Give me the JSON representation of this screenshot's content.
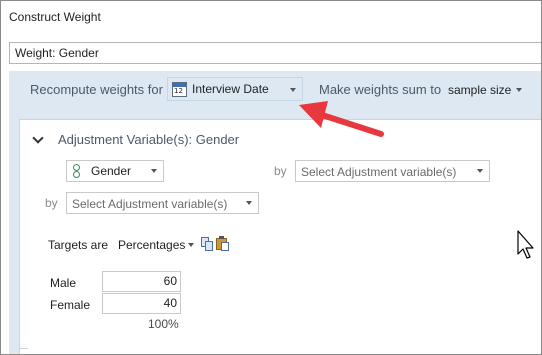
{
  "window": {
    "title": "Construct Weight"
  },
  "weight_name": {
    "value": "Weight: Gender"
  },
  "recompute": {
    "label": "Recompute weights for",
    "selected": "Interview Date",
    "icon": "calendar-icon",
    "icon_text": "12"
  },
  "sum": {
    "label": "Make weights sum to",
    "selected": "sample size"
  },
  "adjustment": {
    "title": "Adjustment Variable(s): Gender",
    "variable": "Gender",
    "by_label": "by",
    "placeholder": "Select Adjustment variable(s)"
  },
  "targets": {
    "label": "Targets are",
    "mode": "Percentages",
    "rows": [
      {
        "label": "Male",
        "value": "60"
      },
      {
        "label": "Female",
        "value": "40"
      }
    ],
    "total": "100%"
  },
  "colors": {
    "panel_bg": "#dde8f3",
    "arrow": "#e8383d"
  }
}
